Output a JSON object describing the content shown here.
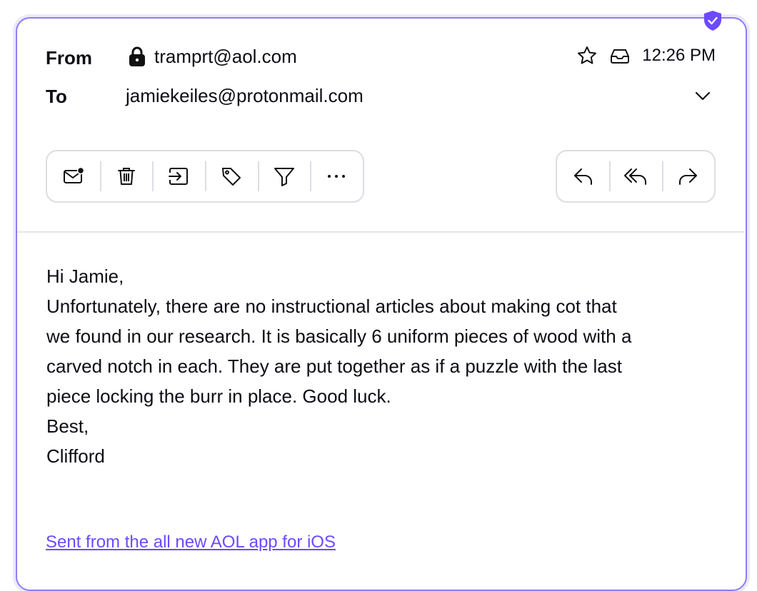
{
  "header": {
    "from_label": "From",
    "from_address": "tramprt@aol.com",
    "to_label": "To",
    "to_address": "jamiekeiles@protonmail.com",
    "time": "12:26 PM"
  },
  "icons": {
    "lock": "lock-icon",
    "star": "star-icon",
    "inbox": "inbox-icon",
    "expand": "chevron-down-icon",
    "shield": "shield-check-icon"
  },
  "toolbar_left": [
    "mark-unread-icon",
    "trash-icon",
    "move-icon",
    "label-icon",
    "filter-icon",
    "more-icon"
  ],
  "toolbar_right": [
    "reply-icon",
    "reply-all-icon",
    "forward-icon"
  ],
  "message": {
    "greeting": "Hi Jamie,",
    "lines": [
      "Unfortunately, there are no instructional articles about making cot that",
      "we found in our research. It is basically 6 uniform pieces of wood with a",
      "carved notch in each. They are put together as if a puzzle with the last",
      "piece locking the burr in place. Good luck."
    ],
    "closing": "Best,",
    "name": "Clifford",
    "signature_link": "Sent from the all new AOL app for iOS"
  },
  "colors": {
    "accent": "#6d4aff",
    "border": "#8f7cf0"
  }
}
